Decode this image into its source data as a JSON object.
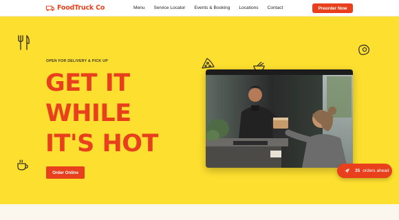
{
  "header": {
    "brand": "FoodTruck Co",
    "logo_icon": "food-truck-icon",
    "nav": [
      "Menu",
      "Service Locator",
      "Events & Booking",
      "Locations",
      "Contact"
    ],
    "cta_label": "Preorder Now"
  },
  "hero": {
    "eyebrow": "OPEN FOR DELIVERY & PICK UP",
    "headline": [
      "GET IT",
      "WHILE",
      "IT'S HOT"
    ],
    "order_button": "Order Online",
    "orders_badge": {
      "count": "35",
      "label": "orders ahead",
      "icon": "rocket-icon"
    },
    "decor_icons": [
      "fork-knife-icon",
      "pizza-slice-icon",
      "noodle-bowl-icon",
      "steak-icon",
      "coffee-cup-icon"
    ]
  },
  "colors": {
    "accent": "#e8401c",
    "hero_background": "#fde02f"
  }
}
